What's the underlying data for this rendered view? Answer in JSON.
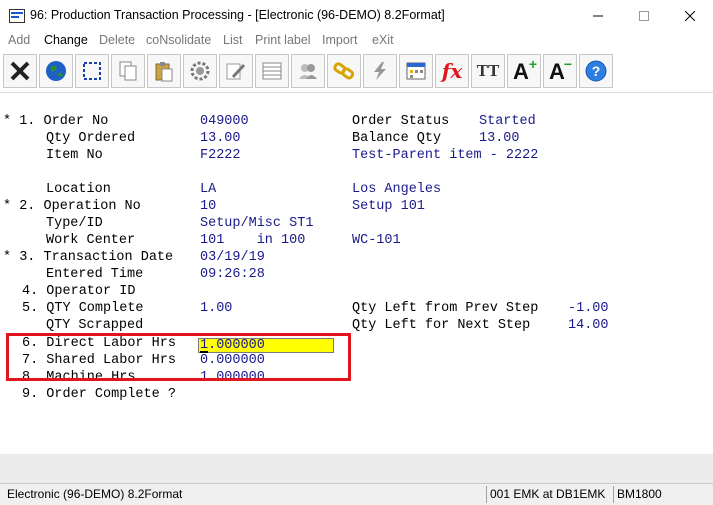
{
  "window": {
    "title": "96: Production Transaction Processing - [Electronic (96-DEMO) 8.2Format]"
  },
  "menu": {
    "items": [
      "Add",
      "Change",
      "Delete",
      "coNsolidate",
      "List",
      "Print label",
      "Import",
      "eXit"
    ],
    "active": "Change"
  },
  "toolbar": {
    "buttons": [
      "exit-icon",
      "globe-icon",
      "select-icon",
      "copy-icon",
      "paste-icon",
      "settings-icon",
      "edit-icon",
      "list-icon",
      "users-icon",
      "link-icon",
      "lightning-icon",
      "calculator-icon",
      "function-icon",
      "font-icon",
      "font-increase-icon",
      "font-decrease-icon",
      "help-icon"
    ],
    "fx_label": "fx",
    "tt_label": "TT",
    "a_label": "A"
  },
  "form": {
    "order_no_label": "* 1. Order No",
    "order_no": "049000",
    "order_status_label": "Order Status",
    "order_status": "Started",
    "qty_ordered_label": "Qty Ordered",
    "qty_ordered": "13.00",
    "balance_qty_label": "Balance Qty",
    "balance_qty": "13.00",
    "item_no_label": "Item No",
    "item_no": "F2222",
    "item_desc": "Test-Parent item - 2222",
    "location_label": "Location",
    "location": "LA",
    "location_name": "Los Angeles",
    "operation_no_label": "* 2. Operation No",
    "operation_no": "10",
    "operation_desc": "Setup 101",
    "type_id_label": "Type/ID",
    "type_id": "Setup/Misc ST1",
    "work_center_label": "Work Center",
    "work_center": "101    in 100",
    "work_center_code": "WC-101",
    "transaction_date_label": "* 3. Transaction Date",
    "transaction_date": "03/19/19",
    "entered_time_label": "Entered Time",
    "entered_time": "09:26:28",
    "operator_id_label": "4. Operator ID",
    "qty_complete_label": "5. QTY Complete",
    "qty_complete": "1.00",
    "qty_left_prev_label": "Qty Left from Prev Step",
    "qty_left_prev": "-1.00",
    "qty_scrapped_label": "QTY Scrapped",
    "qty_left_next_label": "Qty Left for Next Step",
    "qty_left_next": "14.00",
    "direct_labor_label": "6. Direct Labor Hrs",
    "direct_labor": "1.000000",
    "shared_labor_label": "7. Shared Labor Hrs",
    "shared_labor": "0.000000",
    "machine_hrs_label": "8. Machine Hrs",
    "machine_hrs": "1.000000",
    "order_complete_label": "9. Order Complete ?"
  },
  "status": {
    "company": "Electronic (96-DEMO) 8.2Format",
    "user_db": "001 EMK at DB1EMK",
    "code": "BM1800"
  }
}
